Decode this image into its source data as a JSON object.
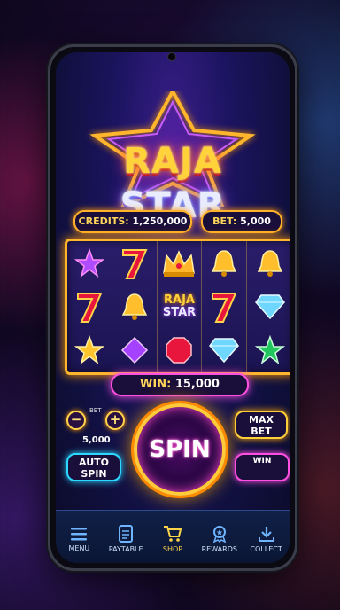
{
  "game": {
    "title_line1": "RAJA",
    "title_line2": "STAR",
    "credits_label": "CREDITS:",
    "credits_value": "1,250,000",
    "bet_label": "BET:",
    "bet_value": "5,000",
    "win_label": "WIN:",
    "win_value": "15,000"
  },
  "reels": {
    "symbols": [
      [
        "purple-star",
        "red-seven",
        "crown",
        "gold-bell",
        "gold-bell"
      ],
      [
        "red-seven",
        "gold-bell",
        "raja-star-wild",
        "red-seven",
        "blue-diamond"
      ],
      [
        "gold-star",
        "purple-gem",
        "red-gem",
        "blue-diamond",
        "green-star"
      ]
    ],
    "wild_line1": "RAJA",
    "wild_line2": "STAR"
  },
  "controls": {
    "bet_title": "BET",
    "bet_amount": "5,000",
    "minus": "−",
    "plus": "+",
    "spin_label": "SPIN",
    "max_bet_line1": "MAX",
    "max_bet_line2": "BET",
    "auto_spin_line1": "AUTO",
    "auto_spin_line2": "SPIN",
    "win_label": "WIN"
  },
  "nav": {
    "items": [
      {
        "label": "MENU",
        "icon": "menu-icon"
      },
      {
        "label": "PAYTABLE",
        "icon": "paytable-icon"
      },
      {
        "label": "SHOP",
        "icon": "cart-icon"
      },
      {
        "label": "REWARDS",
        "icon": "medal-icon"
      },
      {
        "label": "COLLECT",
        "icon": "download-icon"
      }
    ]
  },
  "colors": {
    "gold": "#ffb62c",
    "pink": "#ff4fe0",
    "cyan": "#2cd8ff"
  }
}
